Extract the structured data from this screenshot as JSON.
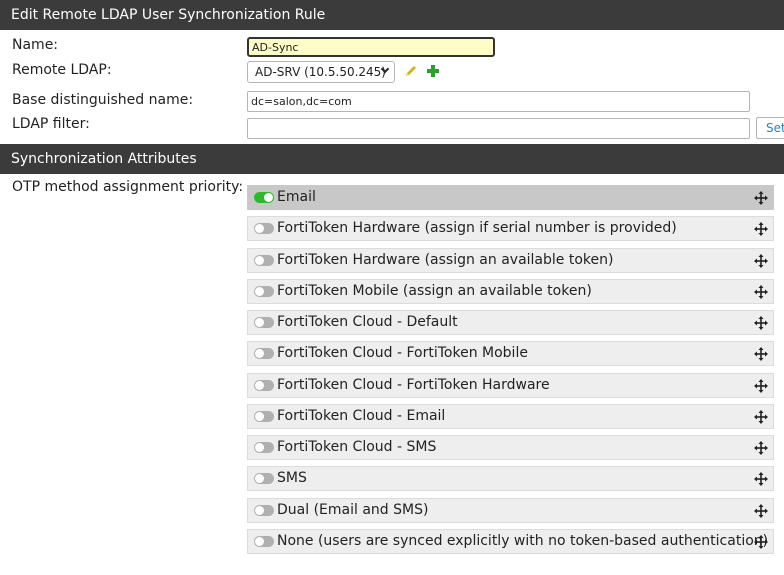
{
  "header": {
    "title": "Edit Remote LDAP User Synchronization Rule"
  },
  "form": {
    "name_label": "Name:",
    "name_value": "AD-Sync",
    "remote_ldap_label": "Remote LDAP:",
    "remote_ldap_value": "AD-SRV (10.5.50.245)",
    "base_dn_label": "Base distinguished name:",
    "base_dn_value": "dc=salon,dc=com",
    "ldap_filter_label": "LDAP filter:",
    "ldap_filter_value": "",
    "set_button_label": "Set"
  },
  "icons": {
    "edit": "pencil-icon",
    "add": "plus-icon",
    "move": "move-icon"
  },
  "sync": {
    "title": "Synchronization Attributes",
    "otp_label": "OTP method assignment priority:",
    "items": [
      {
        "label": "Email",
        "enabled": true
      },
      {
        "label": "FortiToken Hardware (assign if serial number is provided)",
        "enabled": false
      },
      {
        "label": "FortiToken Hardware (assign an available token)",
        "enabled": false
      },
      {
        "label": "FortiToken Mobile (assign an available token)",
        "enabled": false
      },
      {
        "label": "FortiToken Cloud - Default",
        "enabled": false
      },
      {
        "label": "FortiToken Cloud - FortiToken Mobile",
        "enabled": false
      },
      {
        "label": "FortiToken Cloud - FortiToken Hardware",
        "enabled": false
      },
      {
        "label": "FortiToken Cloud - Email",
        "enabled": false
      },
      {
        "label": "FortiToken Cloud - SMS",
        "enabled": false
      },
      {
        "label": "SMS",
        "enabled": false
      },
      {
        "label": "Dual (Email and SMS)",
        "enabled": false
      },
      {
        "label": "None (users are synced explicitly with no token-based authentication)",
        "enabled": false
      }
    ]
  },
  "colors": {
    "header_bg": "#3b3b3b",
    "toggle_on": "#2eb82e",
    "toggle_off": "#b0b0b0",
    "edit_icon": "#d4b21c",
    "add_icon": "#2f9e2f",
    "link": "#2a7fc1"
  }
}
